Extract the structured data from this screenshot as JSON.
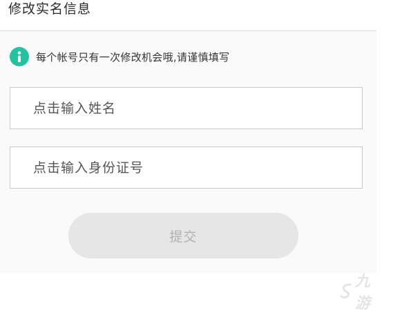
{
  "header": {
    "title": "修改实名信息"
  },
  "notice": {
    "icon": "info-icon",
    "icon_color": "#22c3a0",
    "text": "每个帐号只有一次修改机会哦,请谨慎填写"
  },
  "form": {
    "name_field": {
      "placeholder": "点击输入姓名",
      "value": ""
    },
    "id_field": {
      "placeholder": "点击输入身份证号",
      "value": ""
    },
    "submit_label": "提交",
    "submit_state": "disabled"
  },
  "watermark": {
    "text": "九游"
  }
}
